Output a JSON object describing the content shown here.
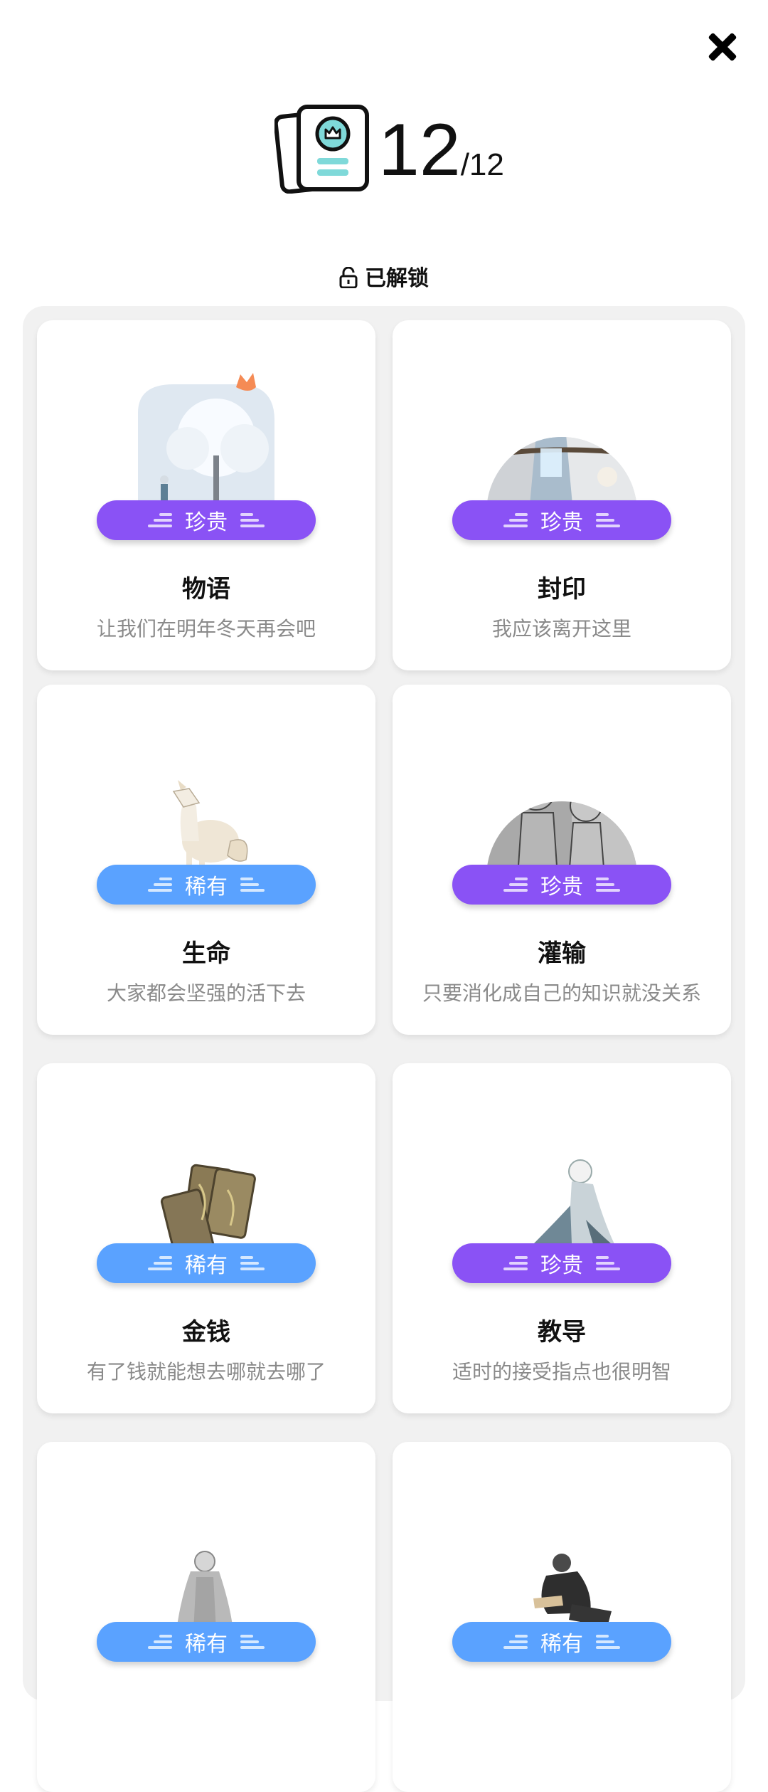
{
  "header": {
    "count": "12",
    "total": "/12"
  },
  "section": {
    "title": "已解锁"
  },
  "cards": [
    {
      "title": "物语",
      "subtitle": "让我们在明年冬天再会吧",
      "badge": "珍贵",
      "rarity": "precious",
      "art": "snow-tree-crown"
    },
    {
      "title": "封印",
      "subtitle": "我应该离开这里",
      "badge": "珍贵",
      "rarity": "precious",
      "art": "seal-figure"
    },
    {
      "title": "生命",
      "subtitle": "大家都会坚强的活下去",
      "badge": "稀有",
      "rarity": "rare",
      "art": "fox"
    },
    {
      "title": "灌输",
      "subtitle": "只要消化成自己的知识就没关系",
      "badge": "珍贵",
      "rarity": "precious",
      "art": "sketch-children"
    },
    {
      "title": "金钱",
      "subtitle": "有了钱就能想去哪就去哪了",
      "badge": "稀有",
      "rarity": "rare",
      "art": "gold-coins"
    },
    {
      "title": "教导",
      "subtitle": "适时的接受指点也很明智",
      "badge": "珍贵",
      "rarity": "precious",
      "art": "kneeling-figure"
    },
    {
      "title": "",
      "subtitle": "",
      "badge": "稀有",
      "rarity": "rare",
      "art": "robed-figure"
    },
    {
      "title": "",
      "subtitle": "",
      "badge": "稀有",
      "rarity": "rare",
      "art": "sitting-figure"
    }
  ],
  "colors": {
    "rare": "#5aa2ff",
    "precious": "#8a52f5",
    "panel": "#f1f1f1"
  }
}
